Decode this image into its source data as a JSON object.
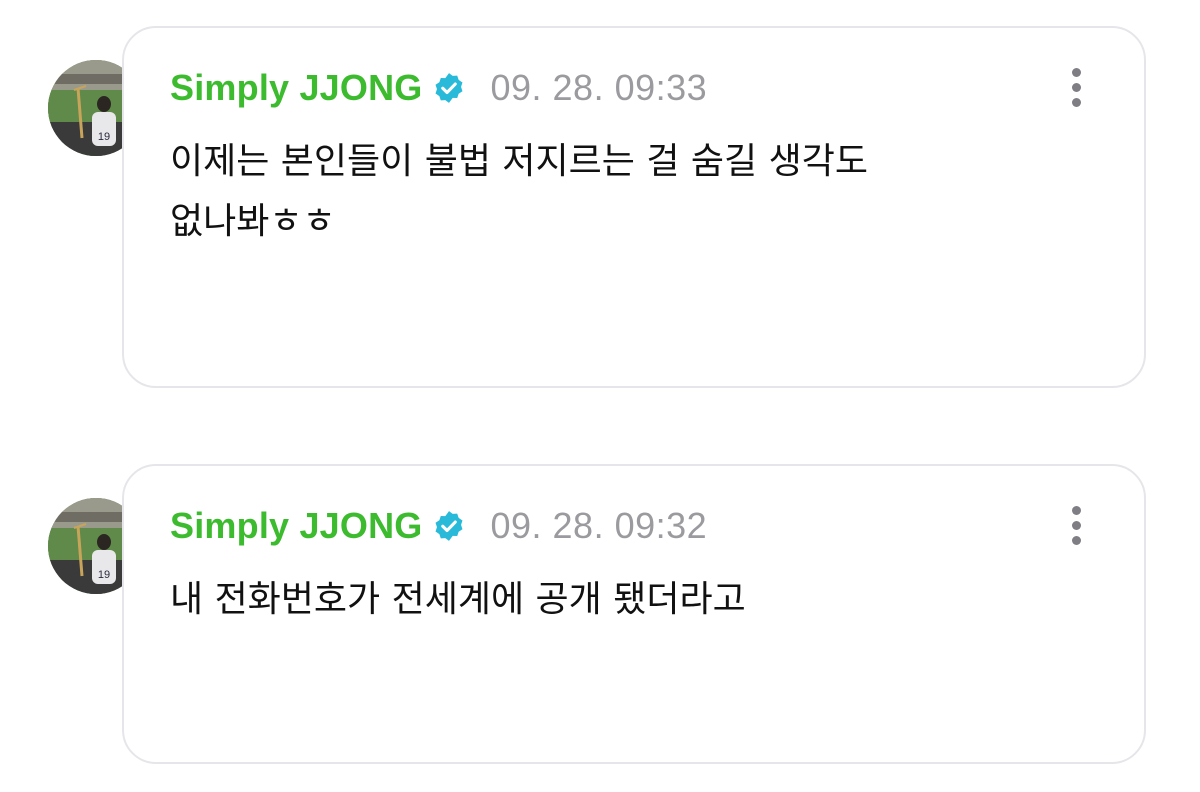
{
  "posts": [
    {
      "author": "Simply JJONG",
      "verified": true,
      "timestamp": "09. 28. 09:33",
      "text": "이제는 본인들이 불법 저지르는 걸 숨길 생각도\n없나봐ㅎㅎ"
    },
    {
      "author": "Simply JJONG",
      "verified": true,
      "timestamp": "09. 28. 09:32",
      "text": "내 전화번호가 전세계에 공개 됐더라고"
    }
  ],
  "icons": {
    "verified": "verified-badge-icon",
    "more": "more-options-icon"
  },
  "colors": {
    "author": "#3dbb2f",
    "verified_badge": "#29b9d9",
    "timestamp": "#9a9a9f",
    "bubble_border": "#e6e6ea"
  }
}
